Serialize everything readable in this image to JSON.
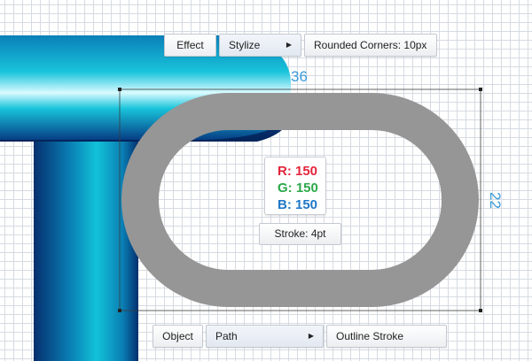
{
  "top_menu": {
    "effect_label": "Effect",
    "stylize_label": "Stylize",
    "rounded_corners_label": "Rounded Corners: 10px"
  },
  "bottom_menu": {
    "object_label": "Object",
    "path_label": "Path",
    "outline_stroke_label": "Outline Stroke"
  },
  "color_info": {
    "r_label": "R: 150",
    "g_label": "G: 150",
    "b_label": "B: 150"
  },
  "stroke_label": "Stroke: 4pt",
  "dimensions": {
    "width_label": "36",
    "height_label": "22"
  },
  "icons": {
    "submenu_arrow": "triangle-right-icon"
  },
  "colors": {
    "stroke_gray": "#969696",
    "r_color": "#e3243b",
    "g_color": "#2ba84a",
    "b_color": "#1f78c8",
    "dimension_blue": "#3a9ad9",
    "mushroom_teal": "#0aa6c6"
  }
}
